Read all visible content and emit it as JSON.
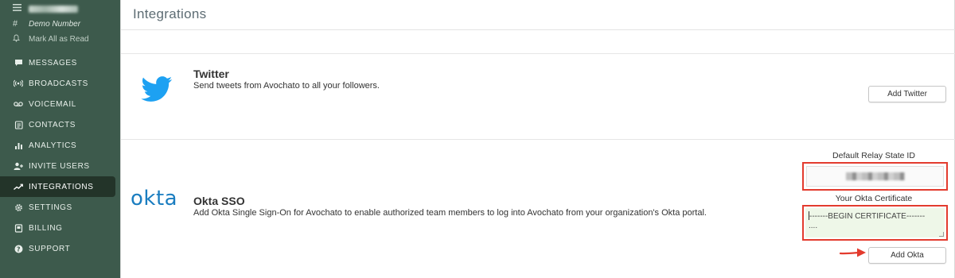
{
  "sidebar": {
    "user_name": "",
    "number_label": "Demo Number",
    "mark_all_read": "Mark All as Read",
    "nav": [
      {
        "label": "MESSAGES",
        "icon": "message-icon"
      },
      {
        "label": "BROADCASTS",
        "icon": "broadcast-icon"
      },
      {
        "label": "VOICEMAIL",
        "icon": "voicemail-icon"
      },
      {
        "label": "CONTACTS",
        "icon": "contacts-icon"
      },
      {
        "label": "ANALYTICS",
        "icon": "analytics-icon"
      },
      {
        "label": "INVITE USERS",
        "icon": "invite-users-icon"
      },
      {
        "label": "INTEGRATIONS",
        "icon": "integrations-icon",
        "active": true
      },
      {
        "label": "SETTINGS",
        "icon": "gear-icon"
      },
      {
        "label": "BILLING",
        "icon": "billing-icon"
      },
      {
        "label": "SUPPORT",
        "icon": "support-icon"
      }
    ]
  },
  "page": {
    "title": "Integrations"
  },
  "twitter": {
    "title": "Twitter",
    "description": "Send tweets from Avochato to all your followers.",
    "button_label": "Add Twitter",
    "icon_color": "#1da1f2"
  },
  "okta": {
    "logo_text": "okta",
    "title": "Okta SSO",
    "description": "Add Okta Single Sign-On for Avochato to enable authorized team members to log into Avochato from your organization's Okta portal.",
    "relay_label": "Default Relay State ID",
    "relay_value": "",
    "cert_label": "Your Okta Certificate",
    "cert_line1": "-------BEGIN CERTIFICATE-------",
    "cert_line2": "....",
    "button_label": "Add Okta",
    "logo_color": "#1a7dc0"
  },
  "colors": {
    "sidebar_bg": "#3d5a4c",
    "annotation_red": "#e33b2e"
  }
}
